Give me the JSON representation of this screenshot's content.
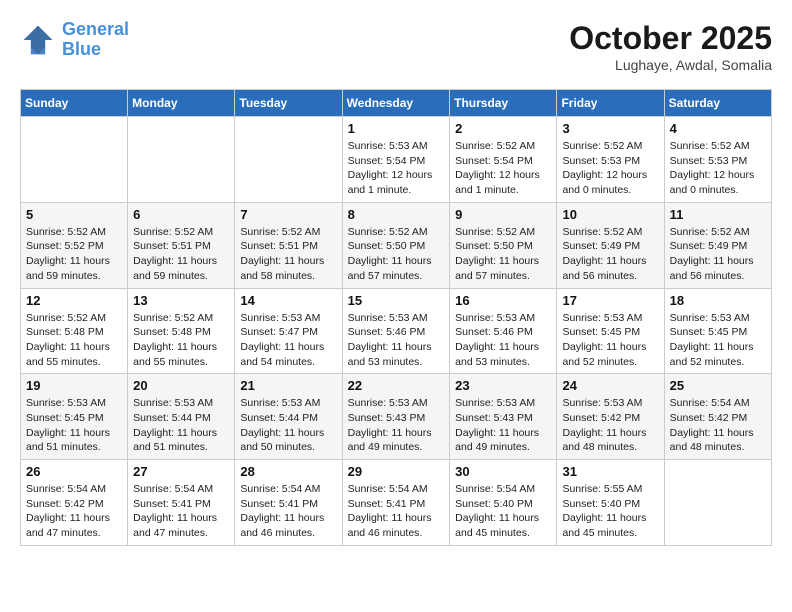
{
  "header": {
    "logo_line1": "General",
    "logo_line2": "Blue",
    "month_title": "October 2025",
    "location": "Lughaye, Awdal, Somalia"
  },
  "days_of_week": [
    "Sunday",
    "Monday",
    "Tuesday",
    "Wednesday",
    "Thursday",
    "Friday",
    "Saturday"
  ],
  "weeks": [
    [
      {
        "day": "",
        "info": ""
      },
      {
        "day": "",
        "info": ""
      },
      {
        "day": "",
        "info": ""
      },
      {
        "day": "1",
        "info": "Sunrise: 5:53 AM\nSunset: 5:54 PM\nDaylight: 12 hours\nand 1 minute."
      },
      {
        "day": "2",
        "info": "Sunrise: 5:52 AM\nSunset: 5:54 PM\nDaylight: 12 hours\nand 1 minute."
      },
      {
        "day": "3",
        "info": "Sunrise: 5:52 AM\nSunset: 5:53 PM\nDaylight: 12 hours\nand 0 minutes."
      },
      {
        "day": "4",
        "info": "Sunrise: 5:52 AM\nSunset: 5:53 PM\nDaylight: 12 hours\nand 0 minutes."
      }
    ],
    [
      {
        "day": "5",
        "info": "Sunrise: 5:52 AM\nSunset: 5:52 PM\nDaylight: 11 hours\nand 59 minutes."
      },
      {
        "day": "6",
        "info": "Sunrise: 5:52 AM\nSunset: 5:51 PM\nDaylight: 11 hours\nand 59 minutes."
      },
      {
        "day": "7",
        "info": "Sunrise: 5:52 AM\nSunset: 5:51 PM\nDaylight: 11 hours\nand 58 minutes."
      },
      {
        "day": "8",
        "info": "Sunrise: 5:52 AM\nSunset: 5:50 PM\nDaylight: 11 hours\nand 57 minutes."
      },
      {
        "day": "9",
        "info": "Sunrise: 5:52 AM\nSunset: 5:50 PM\nDaylight: 11 hours\nand 57 minutes."
      },
      {
        "day": "10",
        "info": "Sunrise: 5:52 AM\nSunset: 5:49 PM\nDaylight: 11 hours\nand 56 minutes."
      },
      {
        "day": "11",
        "info": "Sunrise: 5:52 AM\nSunset: 5:49 PM\nDaylight: 11 hours\nand 56 minutes."
      }
    ],
    [
      {
        "day": "12",
        "info": "Sunrise: 5:52 AM\nSunset: 5:48 PM\nDaylight: 11 hours\nand 55 minutes."
      },
      {
        "day": "13",
        "info": "Sunrise: 5:52 AM\nSunset: 5:48 PM\nDaylight: 11 hours\nand 55 minutes."
      },
      {
        "day": "14",
        "info": "Sunrise: 5:53 AM\nSunset: 5:47 PM\nDaylight: 11 hours\nand 54 minutes."
      },
      {
        "day": "15",
        "info": "Sunrise: 5:53 AM\nSunset: 5:46 PM\nDaylight: 11 hours\nand 53 minutes."
      },
      {
        "day": "16",
        "info": "Sunrise: 5:53 AM\nSunset: 5:46 PM\nDaylight: 11 hours\nand 53 minutes."
      },
      {
        "day": "17",
        "info": "Sunrise: 5:53 AM\nSunset: 5:45 PM\nDaylight: 11 hours\nand 52 minutes."
      },
      {
        "day": "18",
        "info": "Sunrise: 5:53 AM\nSunset: 5:45 PM\nDaylight: 11 hours\nand 52 minutes."
      }
    ],
    [
      {
        "day": "19",
        "info": "Sunrise: 5:53 AM\nSunset: 5:45 PM\nDaylight: 11 hours\nand 51 minutes."
      },
      {
        "day": "20",
        "info": "Sunrise: 5:53 AM\nSunset: 5:44 PM\nDaylight: 11 hours\nand 51 minutes."
      },
      {
        "day": "21",
        "info": "Sunrise: 5:53 AM\nSunset: 5:44 PM\nDaylight: 11 hours\nand 50 minutes."
      },
      {
        "day": "22",
        "info": "Sunrise: 5:53 AM\nSunset: 5:43 PM\nDaylight: 11 hours\nand 49 minutes."
      },
      {
        "day": "23",
        "info": "Sunrise: 5:53 AM\nSunset: 5:43 PM\nDaylight: 11 hours\nand 49 minutes."
      },
      {
        "day": "24",
        "info": "Sunrise: 5:53 AM\nSunset: 5:42 PM\nDaylight: 11 hours\nand 48 minutes."
      },
      {
        "day": "25",
        "info": "Sunrise: 5:54 AM\nSunset: 5:42 PM\nDaylight: 11 hours\nand 48 minutes."
      }
    ],
    [
      {
        "day": "26",
        "info": "Sunrise: 5:54 AM\nSunset: 5:42 PM\nDaylight: 11 hours\nand 47 minutes."
      },
      {
        "day": "27",
        "info": "Sunrise: 5:54 AM\nSunset: 5:41 PM\nDaylight: 11 hours\nand 47 minutes."
      },
      {
        "day": "28",
        "info": "Sunrise: 5:54 AM\nSunset: 5:41 PM\nDaylight: 11 hours\nand 46 minutes."
      },
      {
        "day": "29",
        "info": "Sunrise: 5:54 AM\nSunset: 5:41 PM\nDaylight: 11 hours\nand 46 minutes."
      },
      {
        "day": "30",
        "info": "Sunrise: 5:54 AM\nSunset: 5:40 PM\nDaylight: 11 hours\nand 45 minutes."
      },
      {
        "day": "31",
        "info": "Sunrise: 5:55 AM\nSunset: 5:40 PM\nDaylight: 11 hours\nand 45 minutes."
      },
      {
        "day": "",
        "info": ""
      }
    ]
  ]
}
